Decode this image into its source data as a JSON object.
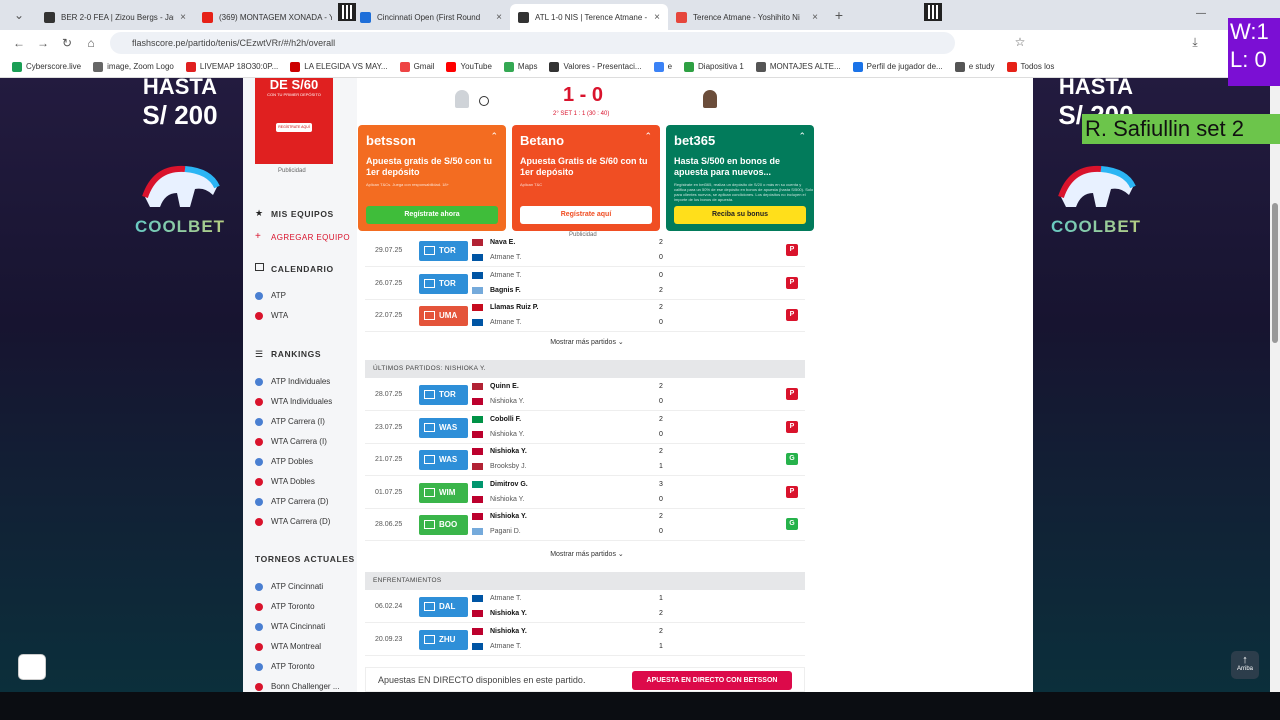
{
  "browser": {
    "tabs": [
      {
        "title": "BER 2-0 FEA | Zizou Bergs - Jaum",
        "color": "#333"
      },
      {
        "title": "(369) MONTAGEM XONADA - YouTube",
        "color": "#e62117"
      },
      {
        "title": "Cincinnati Open (First Round",
        "color": "#1e6fd9"
      },
      {
        "title": "ATL 1-0 NIS | Terence Atmane -",
        "color": "#333",
        "active": true
      },
      {
        "title": "Terence Atmane - Yoshihito Ni",
        "color": "#e6463c"
      }
    ],
    "url": "flashscore.pe/partido/tenis/CEzwtVRr/#/h2h/overall",
    "bookmarks": [
      "Cyberscore.live",
      "image, Zoom Logo",
      "LIVEMAP 18O30:0P...",
      "LA ELEGIDA VS MAY...",
      "Gmail",
      "YouTube",
      "Maps",
      "Valores - Presentaci...",
      "e",
      "Diapositiva 1",
      "MONTAJES ALTE...",
      "Perfil de jugador de...",
      "e study",
      "Todos los"
    ]
  },
  "overlay": {
    "wl": "W:1\nL: 0",
    "name": "R. Safiullin set 2"
  },
  "side_ad": {
    "hasta": "HASTA",
    "monto": "S/ 200",
    "monto_right": "S/ 200",
    "brand": "COOLBET"
  },
  "sidebar": {
    "top_ad_main": "DE S/60",
    "top_ad_sub": "CON TU PRIMER DEPÓSITO",
    "top_ad_btn": "REGÍSTRATE AQUÍ",
    "publicidad": "Publicidad",
    "mis_equipos": "MIS EQUIPOS",
    "agregar_equipo": "AGREGAR EQUIPO",
    "calendario": "CALENDARIO",
    "cal_items": [
      "ATP",
      "WTA"
    ],
    "rankings": "RANKINGS",
    "rank_items": [
      "ATP Individuales",
      "WTA Individuales",
      "ATP Carrera (I)",
      "WTA Carrera (I)",
      "ATP Dobles",
      "WTA Dobles",
      "ATP Carrera (D)",
      "WTA Carrera (D)"
    ],
    "torneos": "TORNEOS ACTUALES",
    "torneo_items": [
      "ATP Cincinnati",
      "ATP Toronto",
      "WTA Cincinnati",
      "WTA Montreal",
      "ATP Toronto",
      "Bonn Challenger ..."
    ]
  },
  "match": {
    "score": "1 - 0",
    "set_info": "2° SET  1 : 1 (30 : 40)"
  },
  "bet_cards": [
    {
      "logo": "betsson",
      "text": "Apuesta gratis de S/50 con tu 1er depósito",
      "small": "Aplican T&Cs. Juega con responsabilidad. 18+",
      "btn": "Regístrate ahora",
      "bg": "#f36c21",
      "btn_bg": "#3fbd3a",
      "btn_fg": "#fff"
    },
    {
      "logo": "Betano",
      "text": "Apuesta Gratis de S/60 con tu 1er depósito",
      "small": "Aplican T&C",
      "btn": "Regístrate aquí",
      "bg": "#f04e23",
      "btn_bg": "#ffffff",
      "btn_fg": "#f04e23"
    },
    {
      "logo": "bet365",
      "text": "Hasta S/500 en bonos de apuesta para nuevos...",
      "small": "Regístrate en bet365, realiza un depósito de S/20 o más en su cuenta y califica para un 50% de ese depósito en bonos de apuesta (hasta S/500). Solo para clientes nuevos, se aplican condiciones. Los depósitos no incluyen el importe de los bonos de apuesta.",
      "btn": "Reciba su bonus",
      "bg": "#027b5b",
      "btn_bg": "#ffdf1b",
      "btn_fg": "#222"
    }
  ],
  "publicidad2": "Publicidad",
  "atmane_rows": [
    {
      "date": "29.07.25",
      "tour": "TOR",
      "tour_color": "#2e8fd8",
      "p1": "Nava E.",
      "p2": "Atmane T.",
      "s1": "2",
      "s2": "0",
      "res": "P",
      "w": 1,
      "f1": "#b22234",
      "f2": "#0055a4"
    },
    {
      "date": "26.07.25",
      "tour": "TOR",
      "tour_color": "#2e8fd8",
      "p1": "Atmane T.",
      "p2": "Bagnis F.",
      "s1": "0",
      "s2": "2",
      "res": "P",
      "w": 2,
      "f1": "#0055a4",
      "f2": "#75aadb"
    },
    {
      "date": "22.07.25",
      "tour": "UMA",
      "tour_color": "#e4543a",
      "p1": "Llamas Ruiz P.",
      "p2": "Atmane T.",
      "s1": "2",
      "s2": "0",
      "res": "P",
      "w": 1,
      "f1": "#c60b1e",
      "f2": "#0055a4"
    }
  ],
  "more1": "Mostrar más partidos",
  "nishioka_header": "ÚLTIMOS PARTIDOS: NISHIOKA Y.",
  "nishioka_rows": [
    {
      "date": "28.07.25",
      "tour": "TOR",
      "tour_color": "#2e8fd8",
      "p1": "Quinn E.",
      "p2": "Nishioka Y.",
      "s1": "2",
      "s2": "0",
      "res": "P",
      "w": 1,
      "f1": "#b22234",
      "f2": "#bc002d"
    },
    {
      "date": "23.07.25",
      "tour": "WAS",
      "tour_color": "#2e8fd8",
      "p1": "Cobolli F.",
      "p2": "Nishioka Y.",
      "s1": "2",
      "s2": "0",
      "res": "P",
      "w": 1,
      "f1": "#009246",
      "f2": "#bc002d"
    },
    {
      "date": "21.07.25",
      "tour": "WAS",
      "tour_color": "#2e8fd8",
      "p1": "Nishioka Y.",
      "p2": "Brooksby J.",
      "s1": "2",
      "s2": "1",
      "res": "G",
      "w": 1,
      "f1": "#bc002d",
      "f2": "#b22234"
    },
    {
      "date": "01.07.25",
      "tour": "WIM",
      "tour_color": "#3ab54a",
      "p1": "Dimitrov G.",
      "p2": "Nishioka Y.",
      "s1": "3",
      "s2": "0",
      "res": "P",
      "w": 1,
      "f1": "#00966e",
      "f2": "#bc002d"
    },
    {
      "date": "28.06.25",
      "tour": "BOO",
      "tour_color": "#3ab54a",
      "p1": "Nishioka Y.",
      "p2": "Pagani D.",
      "s1": "2",
      "s2": "0",
      "res": "G",
      "w": 1,
      "f1": "#bc002d",
      "f2": "#75aadb"
    }
  ],
  "more2": "Mostrar más partidos",
  "h2h_header": "ENFRENTAMIENTOS",
  "h2h_rows": [
    {
      "date": "06.02.24",
      "tour": "DAL",
      "tour_color": "#2e8fd8",
      "p1": "Atmane T.",
      "p2": "Nishioka Y.",
      "s1": "1",
      "s2": "2",
      "w": 2,
      "f1": "#0055a4",
      "f2": "#bc002d"
    },
    {
      "date": "20.09.23",
      "tour": "ZHU",
      "tour_color": "#2e8fd8",
      "p1": "Nishioka Y.",
      "p2": "Atmane T.",
      "s1": "2",
      "s2": "1",
      "w": 1,
      "f1": "#bc002d",
      "f2": "#0055a4"
    }
  ],
  "betbar": {
    "text": "Apuestas EN DIRECTO disponibles en este partido.",
    "btn": "APUESTA EN DIRECTO CON BETSSON"
  },
  "arriba": "Arriba",
  "colors": {
    "win": "#26b24b",
    "loss": "#d9132c",
    "accent": "#d9132c"
  }
}
